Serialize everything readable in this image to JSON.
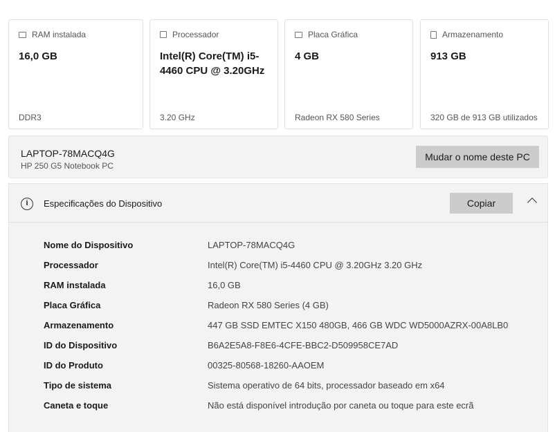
{
  "cards": [
    {
      "title": "RAM instalada",
      "icon": "ram-icon",
      "value": "16,0 GB",
      "sub": "DDR3"
    },
    {
      "title": "Processador",
      "icon": "cpu-icon",
      "value": "Intel(R) Core(TM) i5-4460  CPU @ 3.20GHz",
      "sub": "3.20 GHz"
    },
    {
      "title": "Placa Gráfica",
      "icon": "gpu-icon",
      "value": "4 GB",
      "sub": "Radeon RX 580 Series"
    },
    {
      "title": "Armazenamento",
      "icon": "storage-icon",
      "value": "913 GB",
      "sub": "320 GB de 913 GB utilizados"
    }
  ],
  "device": {
    "name": "LAPTOP-78MACQ4G",
    "model": "HP 250 G5 Notebook PC",
    "rename_label": "Mudar o nome deste PC"
  },
  "specs": {
    "title": "Especificações do Dispositivo",
    "copy_label": "Copiar",
    "rows": [
      {
        "k": "Nome do Dispositivo",
        "v": "LAPTOP-78MACQ4G"
      },
      {
        "k": "Processador",
        "v": "Intel(R) Core(TM) i5-4460  CPU @ 3.20GHz   3.20 GHz"
      },
      {
        "k": "RAM instalada",
        "v": "16,0 GB"
      },
      {
        "k": "Placa Gráfica",
        "v": "Radeon RX 580 Series (4 GB)"
      },
      {
        "k": "Armazenamento",
        "v": "447 GB SSD EMTEC X150 480GB, 466 GB WDC WD5000AZRX-00A8LB0"
      },
      {
        "k": "ID do Dispositivo",
        "v": "B6A2E5A8-F8E6-4CFE-BBC2-D509958CE7AD"
      },
      {
        "k": "ID do Produto",
        "v": "00325-80568-18260-AAOEM"
      },
      {
        "k": "Tipo de sistema",
        "v": "Sistema operativo de 64 bits, processador baseado em x64"
      },
      {
        "k": "Caneta e toque",
        "v": "Não está disponível introdução por caneta ou toque para este ecrã"
      }
    ]
  }
}
